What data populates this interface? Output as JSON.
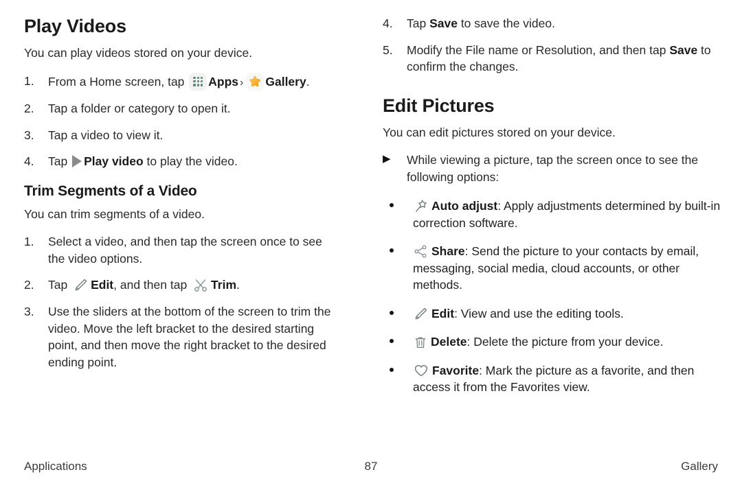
{
  "page": {
    "number": "87",
    "footer_left": "Applications",
    "footer_right": "Gallery"
  },
  "icons": {
    "apps": "apps-grid-icon",
    "gallery": "gallery-star-icon",
    "play": "play-triangle-icon",
    "edit": "pencil-edit-icon",
    "trim": "scissors-trim-icon",
    "auto_adjust": "magic-wand-auto-adjust-icon",
    "share": "share-nodes-icon",
    "delete": "trash-delete-icon",
    "favorite": "heart-favorite-icon",
    "chevron": "›",
    "bullet_triangle": "▶"
  },
  "colors": {
    "text": "#2a2a2a",
    "heading": "#1a1a1a",
    "apps_icon_dots": "#5f8a7d",
    "gallery_star": "#f5a623",
    "gallery_star_light": "#ffc94a",
    "play_triangle": "#8a8a8a",
    "outline_icon": "#6e7b7a",
    "icon_tile_bg": "#f2f2f0"
  },
  "left_column": {
    "title": "Play Videos",
    "intro": "You can play videos stored on your device.",
    "steps": [
      {
        "num": "1.",
        "pre": "From a Home screen, tap ",
        "icon_a": "apps",
        "label_a": "Apps",
        "sep": "›",
        "icon_b": "gallery",
        "label_b": "Gallery",
        "post": "."
      },
      {
        "num": "2.",
        "text": "Tap a folder or category to open it."
      },
      {
        "num": "3.",
        "text": "Tap a video to view it."
      },
      {
        "num": "4.",
        "pre": "Tap ",
        "icon_a": "play",
        "label_a": "Play video",
        "post": " to play the video."
      }
    ],
    "subsection": {
      "title": "Trim Segments of a Video",
      "intro": "You can trim segments of a video.",
      "steps": [
        {
          "num": "1.",
          "text": "Select a video, and then tap the screen once to see the video options."
        },
        {
          "num": "2.",
          "pre": "Tap ",
          "icon_a": "edit",
          "label_a": "Edit",
          "mid": ", and then tap ",
          "icon_b": "trim",
          "label_b": "Trim",
          "post": "."
        },
        {
          "num": "3.",
          "text": "Use the sliders at the bottom of the screen to trim the video. Move the left bracket to the desired starting point, and then move the right bracket to the desired ending point."
        }
      ]
    }
  },
  "right_column": {
    "continued_steps": [
      {
        "num": "4.",
        "pre": "Tap ",
        "bold": "Save",
        "post": " to save the video."
      },
      {
        "num": "5.",
        "pre": "Modify the File name or Resolution, and then tap ",
        "bold": "Save",
        "post": " to confirm the changes."
      }
    ],
    "title": "Edit Pictures",
    "intro": "You can edit pictures stored on your device.",
    "lead_bullet": {
      "marker": "▶",
      "text": "While viewing a picture, tap the screen once to see the following options:"
    },
    "options": [
      {
        "icon": "auto_adjust",
        "label": "Auto adjust",
        "desc": ": Apply adjustments determined by built-in correction software."
      },
      {
        "icon": "share",
        "label": "Share",
        "desc": ": Send the picture to your contacts by email, messaging, social media, cloud accounts, or other methods."
      },
      {
        "icon": "edit",
        "label": "Edit",
        "desc": ": View and use the editing tools."
      },
      {
        "icon": "delete",
        "label": "Delete",
        "desc": ": Delete the picture from your device."
      },
      {
        "icon": "favorite",
        "label": "Favorite",
        "desc": ": Mark the picture as a favorite, and then access it from the Favorites view."
      }
    ]
  }
}
